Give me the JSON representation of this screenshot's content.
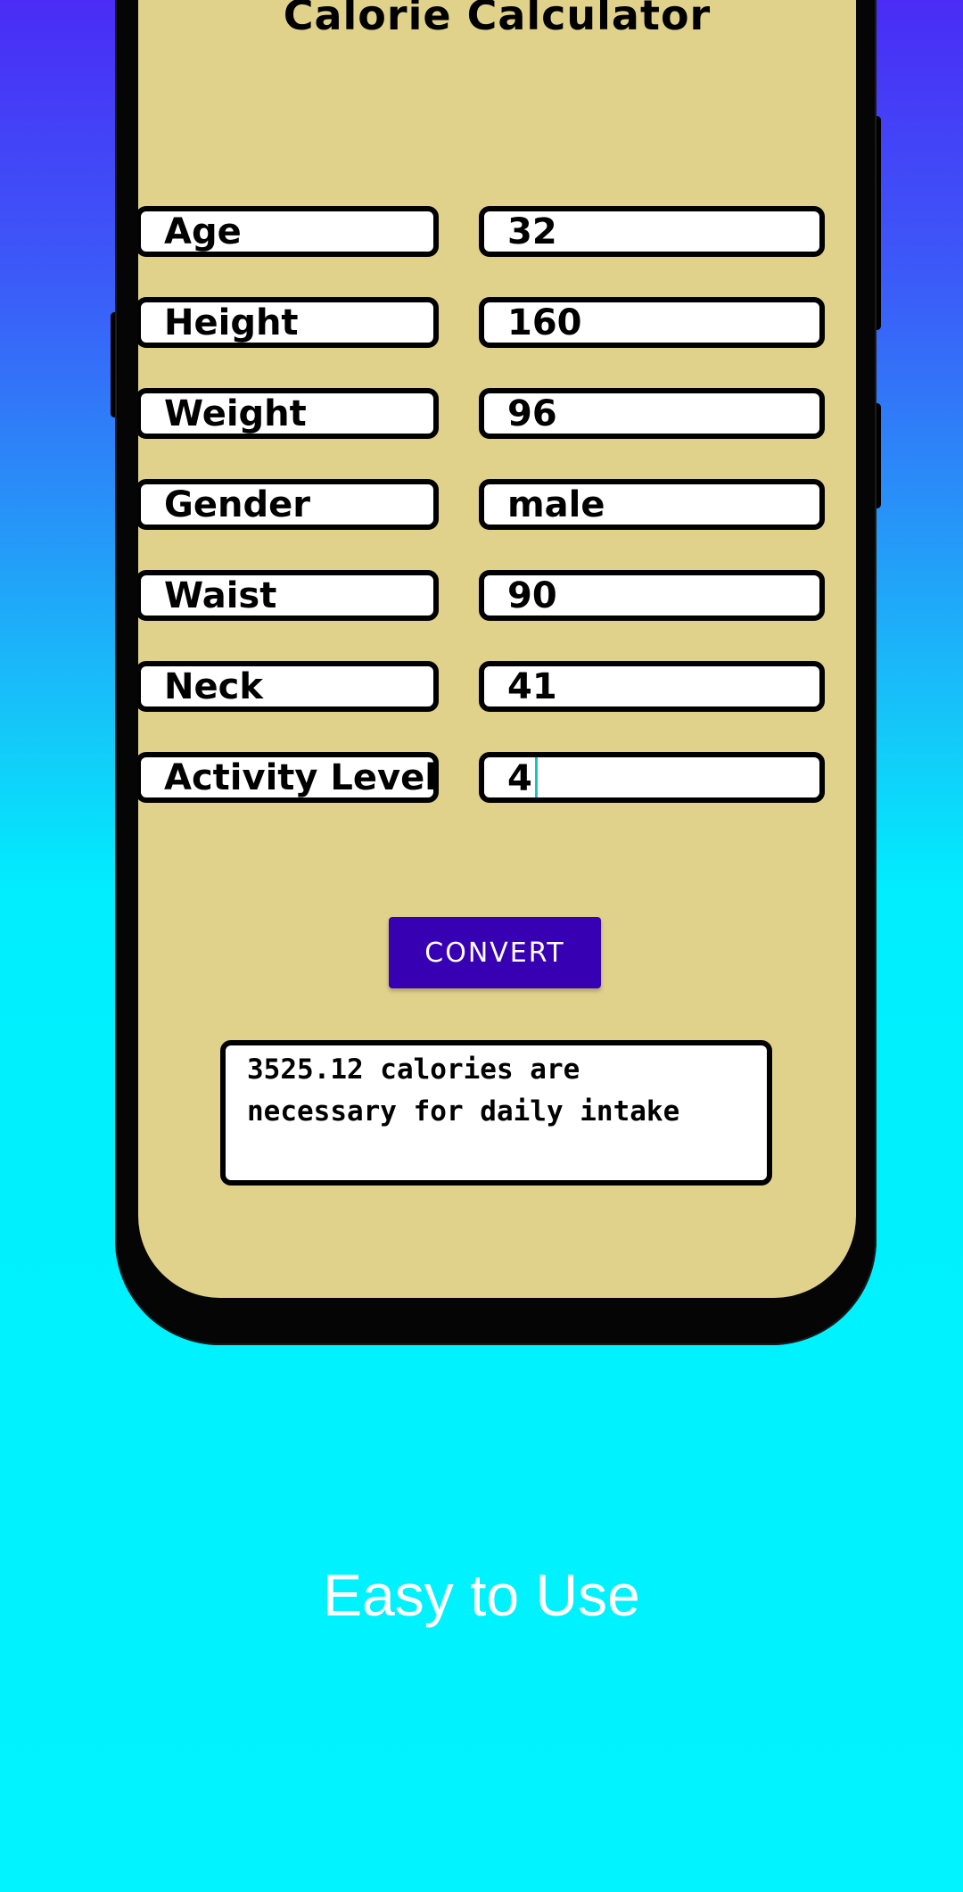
{
  "app": {
    "title": "Calorie Calculator"
  },
  "form": {
    "rows": [
      {
        "label": "Age",
        "value": "32"
      },
      {
        "label": "Height",
        "value": "160"
      },
      {
        "label": "Weight",
        "value": "96"
      },
      {
        "label": "Gender",
        "value": "male"
      },
      {
        "label": "Waist",
        "value": "90"
      },
      {
        "label": "Neck",
        "value": "41"
      },
      {
        "label": "Activity Level",
        "value": "4"
      }
    ]
  },
  "convert_button": {
    "label": "CONVERT"
  },
  "result": {
    "text": "3525.12 calories are necessary for daily intake"
  },
  "tagline": "Easy to Use",
  "colors": {
    "screen_background": "#e1d28b",
    "button": "#3700b3",
    "background_top": "#4a2cf6",
    "background_bottom": "#00f3ff",
    "cursor": "#19c5c0"
  }
}
